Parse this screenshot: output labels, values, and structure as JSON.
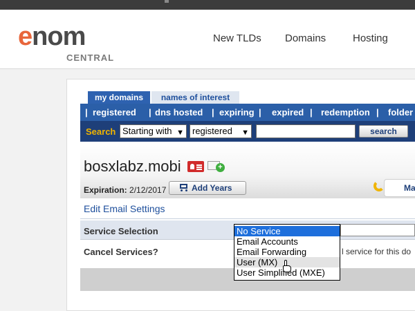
{
  "header": {
    "logo_word_e": "e",
    "logo_word_rest": "nom",
    "logo_sub": "CENTRAL",
    "nav": [
      "New TLDs",
      "Domains",
      "Hosting"
    ]
  },
  "tabs": [
    "my domains",
    "names of interest"
  ],
  "category_bar": {
    "separator": "|",
    "items": [
      "registered",
      "dns hosted",
      "expiring",
      "expired",
      "redemption",
      "folder"
    ]
  },
  "search": {
    "label": "Search",
    "match_select": "Starting with",
    "scope_select": "registered",
    "query": "",
    "button": "search"
  },
  "domain": {
    "name": "bosxlabz.mobi",
    "expiration_label": "Expiration:",
    "expiration_date": "2/12/2017",
    "add_years_button": "Add Years",
    "manage_tab": "Ma"
  },
  "email_settings": {
    "title": "Edit Email Settings",
    "service_label": "Service Selection",
    "cancel_label": "Cancel Services?",
    "cancel_text_visible": "l service for this do",
    "options": [
      "No Service",
      "Email Accounts",
      "Email Forwarding",
      "User (MX)",
      "User Simplified (MXE)"
    ],
    "selected_option": "No Service",
    "hover_option": "User (MX)"
  },
  "colors": {
    "brand_orange": "#e8663b",
    "nav_blue": "#2b5fa8",
    "search_bar": "#1e3f79",
    "search_label": "#f0b400",
    "selected_option": "#1e6fdc"
  }
}
